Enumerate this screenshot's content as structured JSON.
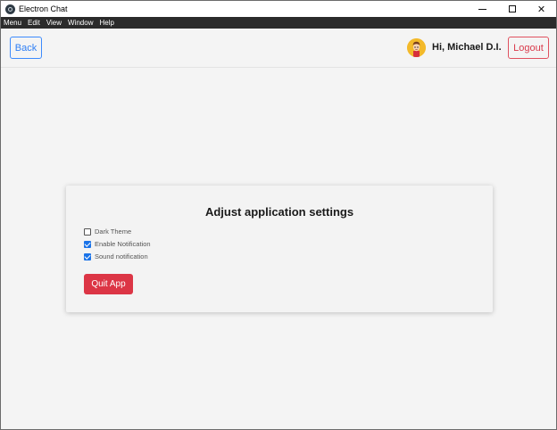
{
  "window": {
    "title": "Electron Chat",
    "controls": {
      "minimize": "minimize-icon",
      "maximize": "maximize-icon",
      "close": "✕"
    }
  },
  "menubar": {
    "items": [
      "Menu",
      "Edit",
      "View",
      "Window",
      "Help"
    ]
  },
  "header": {
    "back_label": "Back",
    "greeting": "Hi, Michael D.I.",
    "logout_label": "Logout",
    "avatar": "user-avatar-icon"
  },
  "settings": {
    "title": "Adjust application settings",
    "options": [
      {
        "label": "Dark Theme",
        "checked": false
      },
      {
        "label": "Enable Notification",
        "checked": true
      },
      {
        "label": "Sound notification",
        "checked": true
      }
    ],
    "quit_label": "Quit App"
  },
  "colors": {
    "primary": "#0d6efd",
    "danger": "#dc3545",
    "menubar": "#2b2b2b",
    "background": "#f4f4f4"
  }
}
